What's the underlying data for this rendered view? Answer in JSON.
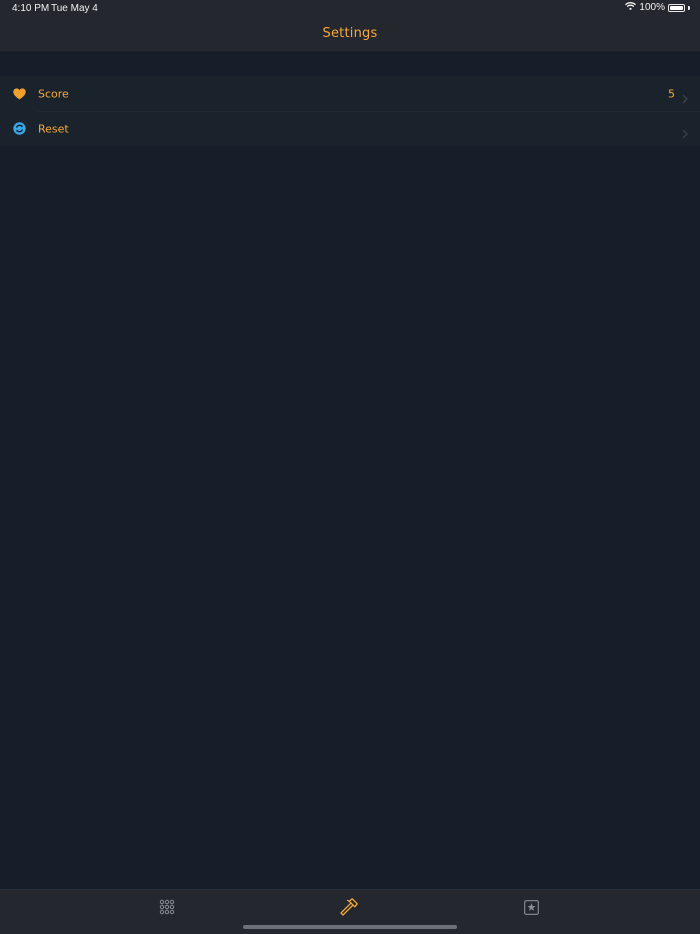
{
  "status_bar": {
    "time": "4:10 PM",
    "date": "Tue May 4",
    "battery_percent": "100%",
    "battery_level": 1.0,
    "icons": [
      "wifi-icon",
      "battery-icon"
    ]
  },
  "nav": {
    "title": "Settings"
  },
  "settings": {
    "items": [
      {
        "label": "Score",
        "value": "5",
        "icon": "heart-icon",
        "icon_color": "#f0a030"
      },
      {
        "label": "Reset",
        "value": "",
        "icon": "reset-icon",
        "icon_color": "#3aa7e6"
      }
    ]
  },
  "tab_bar": {
    "tabs": [
      {
        "icon": "grid-icon",
        "selected": false
      },
      {
        "icon": "hammer-icon",
        "selected": true
      },
      {
        "icon": "star-square-icon",
        "selected": false
      }
    ],
    "accent_color": "#f7a83b",
    "inactive_color": "#8a8d93"
  }
}
